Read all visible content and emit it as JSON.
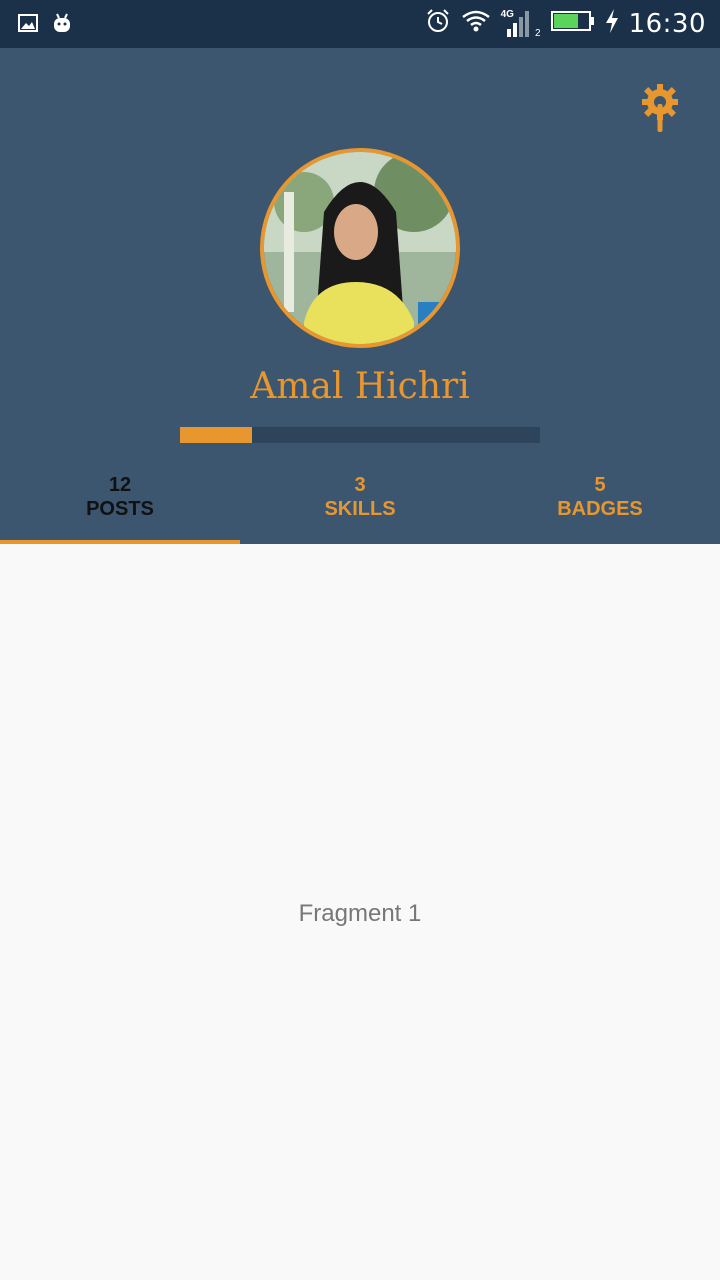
{
  "status_bar": {
    "time": "16:30",
    "network": "4G",
    "sim_slot": "2",
    "icons": [
      "image-icon",
      "android-icon",
      "alarm-icon",
      "wifi-icon",
      "signal-icon",
      "battery-icon",
      "charging-icon"
    ]
  },
  "profile": {
    "name": "Amal Hichri",
    "progress_fraction": 0.2
  },
  "tabs": [
    {
      "count": "12",
      "label": "POSTS",
      "active": true
    },
    {
      "count": "3",
      "label": "SKILLS",
      "active": false
    },
    {
      "count": "5",
      "label": "BADGES",
      "active": false
    }
  ],
  "content": {
    "text": "Fragment 1"
  },
  "colors": {
    "header": "#3c566f",
    "status_bar": "#1a3149",
    "accent": "#e8962e",
    "background": "#f9f9f9"
  }
}
